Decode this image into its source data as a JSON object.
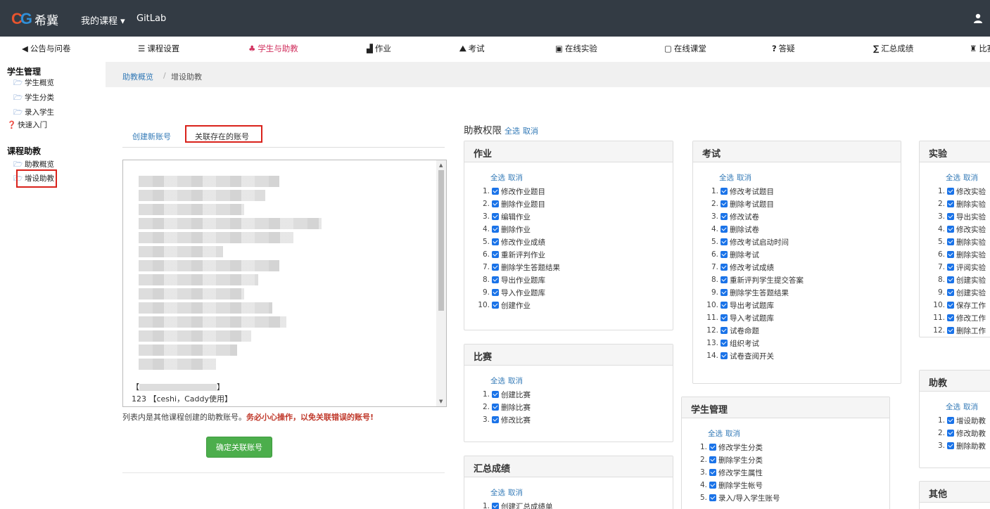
{
  "topbar": {
    "logo_text": "希冀",
    "my_course": "我的课程",
    "gitlab": "GitLab"
  },
  "nav": [
    {
      "icon": "megaphone-icon",
      "glyph": "◀",
      "label": "公告与问卷"
    },
    {
      "icon": "list-icon",
      "glyph": "☰",
      "label": "课程设置"
    },
    {
      "icon": "users-icon",
      "glyph": "👥",
      "label": "学生与助教",
      "active": true
    },
    {
      "icon": "homework-icon",
      "glyph": "▟",
      "label": "作业"
    },
    {
      "icon": "exam-icon",
      "glyph": "⛰",
      "label": "考试"
    },
    {
      "icon": "monitor-icon",
      "glyph": "▣",
      "label": "在线实验"
    },
    {
      "icon": "classroom-icon",
      "glyph": "▢",
      "label": "在线课堂"
    },
    {
      "icon": "question-icon",
      "glyph": "?",
      "label": "答疑"
    },
    {
      "icon": "sigma-icon",
      "glyph": "∑",
      "label": "汇总成绩"
    },
    {
      "icon": "contest-icon",
      "glyph": "♜",
      "label": "比赛"
    }
  ],
  "sidebar": {
    "student_mgmt": "学生管理",
    "student_overview": "学生概览",
    "student_category": "学生分类",
    "enroll_student": "录入学生",
    "quick_start": "快速入门",
    "course_ta": "课程助教",
    "ta_overview": "助教概览",
    "add_ta": "增设助教"
  },
  "breadcrumb": {
    "parent": "助教概览",
    "sep": "/",
    "current": "增设助教"
  },
  "tabs": {
    "create": "创建新账号",
    "link": "关联存在的账号"
  },
  "account_list": {
    "partial_item": "【",
    "partial_item_tail": "】",
    "last_item": "123 【ceshi，Caddy使用】"
  },
  "note": {
    "text": "列表内是其他课程创建的助教账号。",
    "warning": "务必小心操作，以免关联错误的账号!"
  },
  "confirm_button": "确定关联账号",
  "permissions": {
    "title": "助教权限",
    "select_all": "全选",
    "cancel": "取消",
    "homework": {
      "title": "作业",
      "items": [
        "修改作业题目",
        "删除作业题目",
        "编辑作业",
        "删除作业",
        "修改作业成绩",
        "重新评判作业",
        "删除学生答题结果",
        "导出作业题库",
        "导入作业题库",
        "创建作业"
      ]
    },
    "exam": {
      "title": "考试",
      "items": [
        "修改考试题目",
        "删除考试题目",
        "修改试卷",
        "删除试卷",
        "修改考试启动时间",
        "删除考试",
        "修改考试成绩",
        "重新评判学生提交答案",
        "删除学生答题结果",
        "导出考试题库",
        "导入考试题库",
        "试卷命题",
        "组织考试",
        "试卷查阅开关"
      ]
    },
    "lab": {
      "title": "实验",
      "items": [
        "修改实验",
        "删除实验",
        "导出实验",
        "修改实验",
        "删除实验",
        "删除实验",
        "评阅实验",
        "创建实验",
        "创建实验",
        "保存工作",
        "修改工作",
        "删除工作"
      ]
    },
    "contest": {
      "title": "比赛",
      "items": [
        "创建比赛",
        "删除比赛",
        "修改比赛"
      ]
    },
    "student_mgmt": {
      "title": "学生管理",
      "items": [
        "修改学生分类",
        "删除学生分类",
        "修改学生属性",
        "删除学生帐号",
        "录入/导入学生账号"
      ]
    },
    "ta": {
      "title": "助教",
      "items": [
        "增设助教",
        "修改助教",
        "删除助教"
      ]
    },
    "summary": {
      "title": "汇总成绩",
      "items": [
        "创建汇总成绩单"
      ]
    },
    "other": {
      "title": "其他"
    }
  },
  "colors": {
    "topbar": "#333b44",
    "active_nav": "#d1305e",
    "link": "#337ab7",
    "confirm": "#4cae4c",
    "highlight": "#d9221b"
  }
}
